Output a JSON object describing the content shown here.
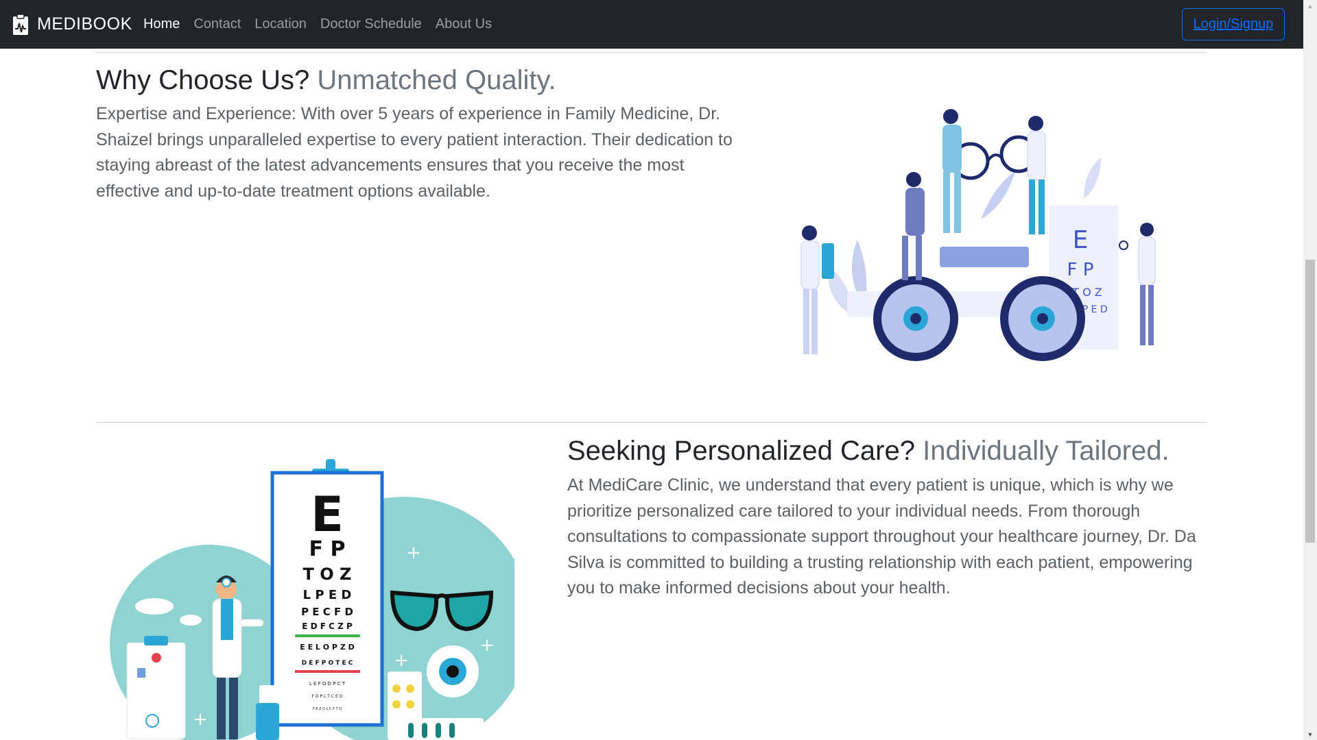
{
  "navbar": {
    "brand": "MEDIBOOK",
    "brand_icon": "clipboard-pulse-icon",
    "links": [
      {
        "label": "Home",
        "active": true
      },
      {
        "label": "Contact",
        "active": false
      },
      {
        "label": "Location",
        "active": false
      },
      {
        "label": "Doctor Schedule",
        "active": false
      },
      {
        "label": "About Us",
        "active": false
      }
    ],
    "login_label": "Login/Signup"
  },
  "section1": {
    "heading_main": "Why Choose Us?",
    "heading_muted": "Unmatched Quality.",
    "body": "Expertise and Experience: With over 5 years of experience in Family Medicine, Dr. Shaizel brings unparalleled expertise to every patient interaction. Their dedication to staying abreast of the latest advancements ensures that you receive the most effective and up-to-date treatment options available."
  },
  "section2": {
    "heading_main": "Seeking Personalized Care?",
    "heading_muted": "Individually Tailored.",
    "body": "At MediCare Clinic, we understand that every patient is unique, which is why we prioritize personalized care tailored to your individual needs. From thorough consultations to compassionate support throughout your healthcare journey, Dr. Da Silva is committed to building a trusting relationship with each patient, empowering you to make informed decisions about your health."
  },
  "eye_chart_1": {
    "rows": [
      "E",
      "F P",
      "T O Z",
      "L P E D"
    ]
  },
  "eye_chart_2": {
    "rows": [
      "E",
      "F P",
      "T O Z",
      "L P E D",
      "P E C F D",
      "E D F C Z P",
      "E E L O P Z D",
      "D E F P O T E C",
      "L E F O D P C T",
      "F D P L T C E O",
      "F E Z O L C F T D"
    ]
  },
  "colors": {
    "navbar_bg": "#212529",
    "accent_blue": "#0d6efd",
    "teal": "#8fd3d3",
    "illustration_blue": "#3f55c9"
  }
}
